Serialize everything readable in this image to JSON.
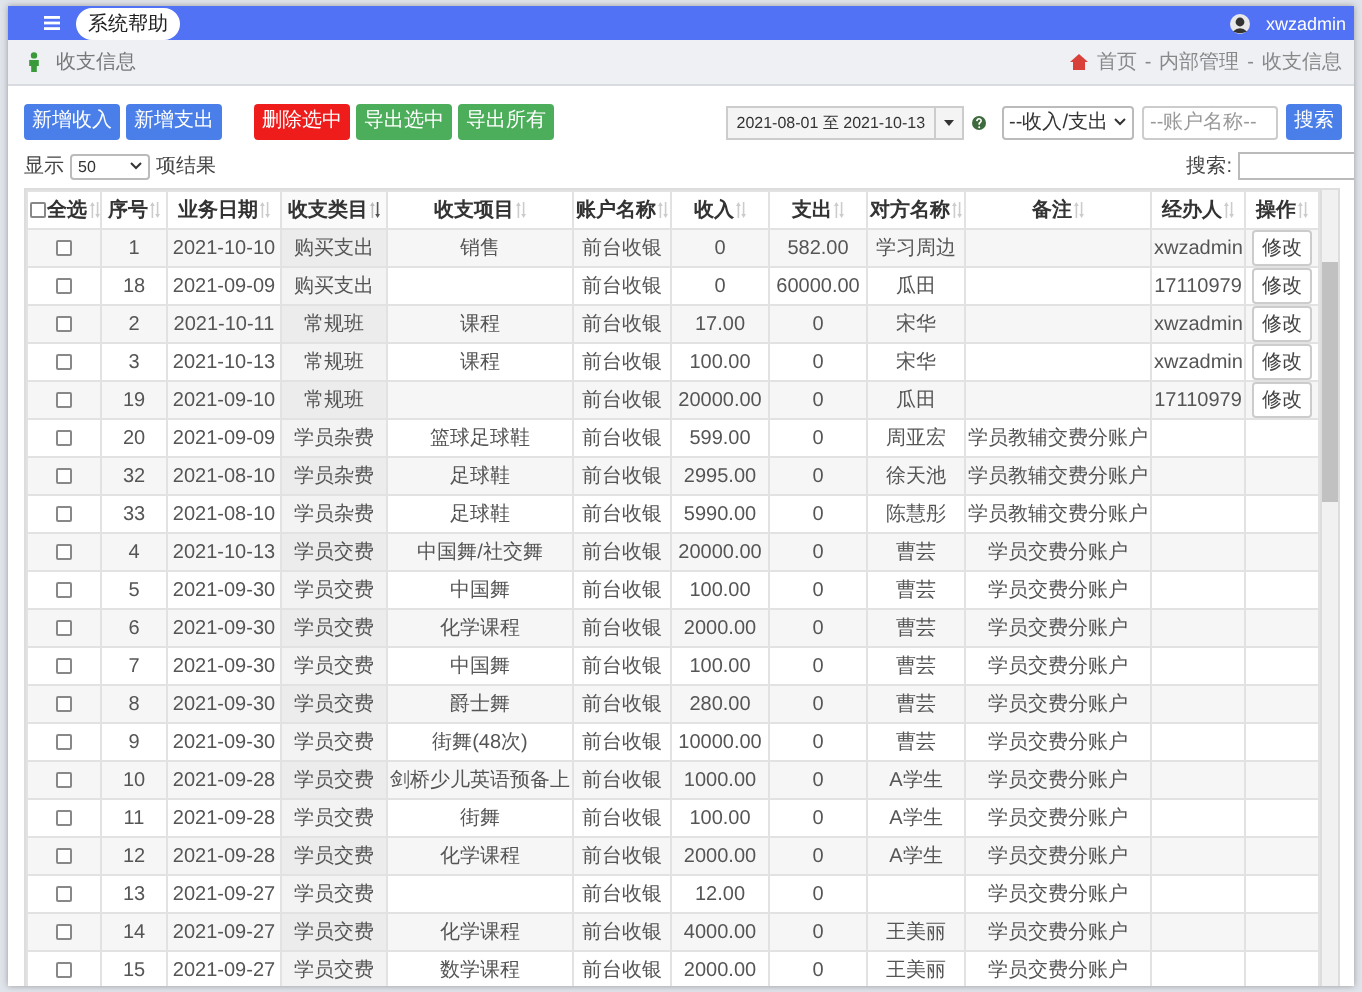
{
  "topbar": {
    "help_button": "系统帮助",
    "user": "xwzadmin"
  },
  "breadcrumb_bar": {
    "title": "收支信息",
    "crumbs": [
      "首页",
      "内部管理",
      "收支信息"
    ],
    "separator": "-"
  },
  "toolbar": {
    "buttons": [
      {
        "label": "新增收入",
        "kind": "primary"
      },
      {
        "label": "新增支出",
        "kind": "primary"
      },
      {
        "label": "删除选中",
        "kind": "danger"
      },
      {
        "label": "导出选中",
        "kind": "success"
      },
      {
        "label": "导出所有",
        "kind": "success"
      }
    ],
    "date_range": "2021-08-01 至 2021-10-13",
    "type_select": "--收入/支出",
    "account_field": {
      "placeholder": "--账户名称--"
    },
    "search_button": "搜索"
  },
  "length_control": {
    "prefix": "显示",
    "value": "50",
    "suffix": "项结果"
  },
  "table_search": {
    "label": "搜索:"
  },
  "table": {
    "select_all": {
      "label": "全选",
      "checked": false
    },
    "columns": [
      {
        "label": "序号",
        "sorted": false
      },
      {
        "label": "业务日期",
        "sorted": false
      },
      {
        "label": "收支类目",
        "sorted": true
      },
      {
        "label": "收支项目",
        "sorted": false
      },
      {
        "label": "账户名称",
        "sorted": false
      },
      {
        "label": "收入",
        "sorted": false
      },
      {
        "label": "支出",
        "sorted": false
      },
      {
        "label": "对方名称",
        "sorted": false
      },
      {
        "label": "备注",
        "sorted": false
      },
      {
        "label": "经办人",
        "sorted": false
      },
      {
        "label": "操作",
        "sorted": false
      }
    ],
    "rows": [
      {
        "checked": false,
        "cells": [
          "1",
          "2021-10-10",
          "购买支出",
          "销售",
          "前台收银",
          "0",
          "582.00",
          "学习周边",
          "",
          "xwzadmin"
        ],
        "action": "修改"
      },
      {
        "checked": false,
        "cells": [
          "18",
          "2021-09-09",
          "购买支出",
          "",
          "前台收银",
          "0",
          "60000.00",
          "瓜田",
          "",
          "17110979"
        ],
        "action": "修改"
      },
      {
        "checked": false,
        "cells": [
          "2",
          "2021-10-11",
          "常规班",
          "课程",
          "前台收银",
          "17.00",
          "0",
          "宋华",
          "",
          "xwzadmin"
        ],
        "action": "修改"
      },
      {
        "checked": false,
        "cells": [
          "3",
          "2021-10-13",
          "常规班",
          "课程",
          "前台收银",
          "100.00",
          "0",
          "宋华",
          "",
          "xwzadmin"
        ],
        "action": "修改"
      },
      {
        "checked": false,
        "cells": [
          "19",
          "2021-09-10",
          "常规班",
          "",
          "前台收银",
          "20000.00",
          "0",
          "瓜田",
          "",
          "17110979"
        ],
        "action": "修改"
      },
      {
        "checked": false,
        "cells": [
          "20",
          "2021-09-09",
          "学员杂费",
          "篮球足球鞋",
          "前台收银",
          "599.00",
          "0",
          "周亚宏",
          "学员教辅交费分账户",
          ""
        ]
      },
      {
        "checked": false,
        "cells": [
          "32",
          "2021-08-10",
          "学员杂费",
          "足球鞋",
          "前台收银",
          "2995.00",
          "0",
          "徐天池",
          "学员教辅交费分账户",
          ""
        ]
      },
      {
        "checked": false,
        "cells": [
          "33",
          "2021-08-10",
          "学员杂费",
          "足球鞋",
          "前台收银",
          "5990.00",
          "0",
          "陈慧彤",
          "学员教辅交费分账户",
          ""
        ]
      },
      {
        "checked": false,
        "cells": [
          "4",
          "2021-10-13",
          "学员交费",
          "中国舞/社交舞",
          "前台收银",
          "20000.00",
          "0",
          "曹芸",
          "学员交费分账户",
          ""
        ]
      },
      {
        "checked": false,
        "cells": [
          "5",
          "2021-09-30",
          "学员交费",
          "中国舞",
          "前台收银",
          "100.00",
          "0",
          "曹芸",
          "学员交费分账户",
          ""
        ]
      },
      {
        "checked": false,
        "cells": [
          "6",
          "2021-09-30",
          "学员交费",
          "化学课程",
          "前台收银",
          "2000.00",
          "0",
          "曹芸",
          "学员交费分账户",
          ""
        ]
      },
      {
        "checked": false,
        "cells": [
          "7",
          "2021-09-30",
          "学员交费",
          "中国舞",
          "前台收银",
          "100.00",
          "0",
          "曹芸",
          "学员交费分账户",
          ""
        ]
      },
      {
        "checked": false,
        "cells": [
          "8",
          "2021-09-30",
          "学员交费",
          "爵士舞",
          "前台收银",
          "280.00",
          "0",
          "曹芸",
          "学员交费分账户",
          ""
        ]
      },
      {
        "checked": false,
        "cells": [
          "9",
          "2021-09-30",
          "学员交费",
          "街舞(48次)",
          "前台收银",
          "10000.00",
          "0",
          "曹芸",
          "学员交费分账户",
          ""
        ]
      },
      {
        "checked": false,
        "cells": [
          "10",
          "2021-09-28",
          "学员交费",
          "剑桥少儿英语预备上",
          "前台收银",
          "1000.00",
          "0",
          "A学生",
          "学员交费分账户",
          ""
        ]
      },
      {
        "checked": false,
        "cells": [
          "11",
          "2021-09-28",
          "学员交费",
          "街舞",
          "前台收银",
          "100.00",
          "0",
          "A学生",
          "学员交费分账户",
          ""
        ]
      },
      {
        "checked": false,
        "cells": [
          "12",
          "2021-09-28",
          "学员交费",
          "化学课程",
          "前台收银",
          "2000.00",
          "0",
          "A学生",
          "学员交费分账户",
          ""
        ]
      },
      {
        "checked": false,
        "cells": [
          "13",
          "2021-09-27",
          "学员交费",
          "",
          "前台收银",
          "12.00",
          "0",
          "",
          "学员交费分账户",
          ""
        ]
      },
      {
        "checked": false,
        "cells": [
          "14",
          "2021-09-27",
          "学员交费",
          "化学课程",
          "前台收银",
          "4000.00",
          "0",
          "王美丽",
          "学员交费分账户",
          ""
        ]
      },
      {
        "checked": false,
        "cells": [
          "15",
          "2021-09-27",
          "学员交费",
          "数学课程",
          "前台收银",
          "2000.00",
          "0",
          "王美丽",
          "学员交费分账户",
          ""
        ]
      }
    ]
  }
}
